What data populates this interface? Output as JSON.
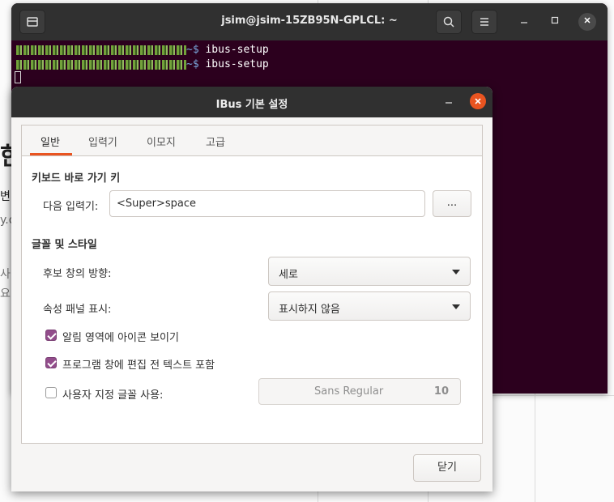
{
  "background": {
    "fragments": [
      "한",
      "변",
      "y.o",
      "사",
      "요"
    ]
  },
  "terminal": {
    "title": "jsim@jsim-15ZB95N-GPLCL: ~",
    "lines": [
      {
        "prompt_suffix": "~$",
        "command": "ibus-setup"
      },
      {
        "prompt_suffix": "~$",
        "command": "ibus-setup"
      }
    ],
    "icons": [
      "new-tab-icon",
      "search-icon",
      "menu-icon",
      "minimize-icon",
      "maximize-icon",
      "close-icon"
    ]
  },
  "dialog": {
    "title": "IBus 기본 설정",
    "tabs": [
      {
        "label": "일반",
        "active": true
      },
      {
        "label": "입력기",
        "active": false
      },
      {
        "label": "이모지",
        "active": false
      },
      {
        "label": "고급",
        "active": false
      }
    ],
    "shortcut_section": {
      "heading": "키보드 바로 가기 키",
      "next_input_label": "다음 입력기:",
      "next_input_value": "<Super>space",
      "more_button_label": "..."
    },
    "font_section": {
      "heading": "글꼴 및 스타일",
      "candidate_orientation_label": "후보 창의 방향:",
      "candidate_orientation_value": "세로",
      "property_panel_label": "속성 패널 표시:",
      "property_panel_value": "표시하지 않음",
      "show_icon_label": "알림 영역에 아이콘 보이기",
      "show_icon_checked": true,
      "embed_preedit_label": "프로그램 창에 편집 전 텍스트 포함",
      "embed_preedit_checked": true,
      "custom_font_label": "사용자 지정 글꼴 사용:",
      "custom_font_checked": false,
      "font_name": "Sans Regular",
      "font_size": "10"
    },
    "close_button_label": "닫기",
    "accent_color": "#e95420",
    "checkbox_color": "#924d8b"
  }
}
